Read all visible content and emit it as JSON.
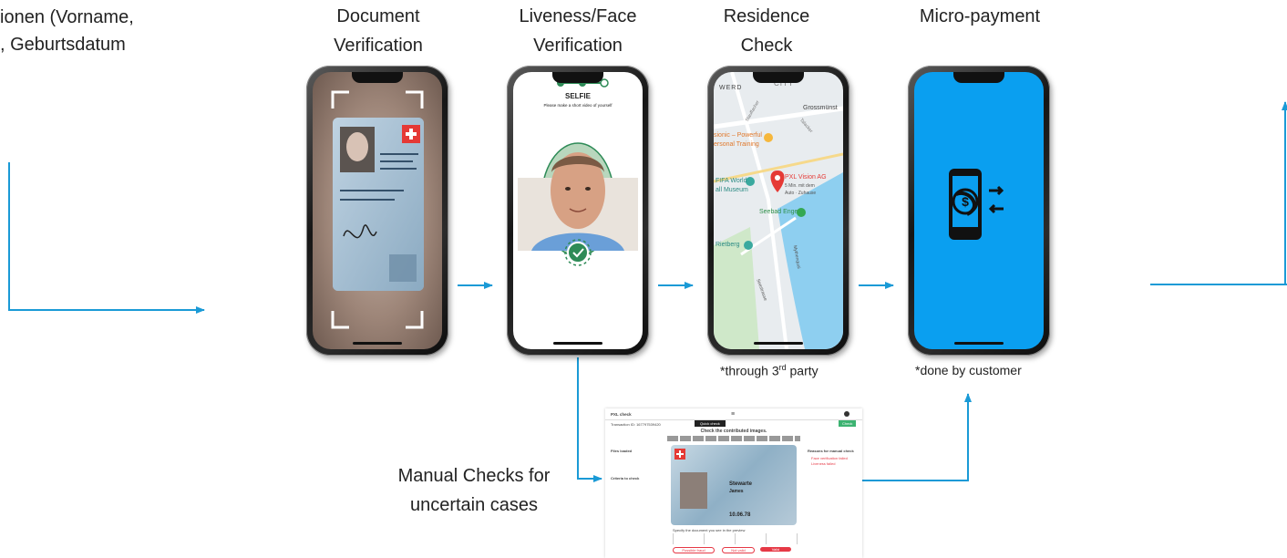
{
  "intro_text": {
    "line1": "ionen (Vorname,",
    "line2": ", Geburtsdatum"
  },
  "steps": [
    {
      "line1": "Document",
      "line2": "Verification"
    },
    {
      "line1": "Liveness/Face",
      "line2": "Verification"
    },
    {
      "line1": "Residence",
      "line2": "Check"
    },
    {
      "line1": "Micro-payment",
      "line2": ""
    }
  ],
  "selfie_screen": {
    "title": "SELFIE",
    "subtitle": "Please make a short video of yourself"
  },
  "map_screen": {
    "labels": [
      "WERD",
      "CITY",
      "Grossmünst",
      "Stauffacher",
      "Talacker",
      "sionic – Powerful",
      "ersonal Training",
      "PXL Vision AG",
      "5 Min. mit dem",
      "Auto · Zuhause",
      "FIFA World",
      "all Museum",
      "Seebad Enge",
      "Rietberg",
      "Mythenquai",
      "Seestrasse"
    ]
  },
  "notes": {
    "third_party": "*through 3",
    "third_party_sup": "rd",
    "third_party_tail": " party",
    "customer": "*done by customer"
  },
  "manual": {
    "line1": "Manual Checks for",
    "line2": "uncertain cases"
  },
  "manual_ui": {
    "logo": "PXL check",
    "transaction": "Transaction ID: 167797539420",
    "quick_check": "Quick check",
    "status_chip": "Check",
    "heading": "Check the contributed images.",
    "left_title": "Files loaded",
    "left_title2": "Criteria to check",
    "right_title": "Reasons for manual check",
    "reason1": "Face verification failed",
    "reason2": "Liveness failed",
    "doc_name": "Stewarte",
    "doc_given": "James",
    "doc_date": "10.06.78",
    "question": "Specify the document you see in the preview",
    "btn_fraud": "Possible fraud",
    "btn_not_valid": "Not valid",
    "btn_valid": "Valid"
  },
  "colors": {
    "arrow": "#1a9ad6",
    "payment_screen": "#0a9ff0",
    "accent_red": "#e63946",
    "verified_green": "#2e8b57"
  },
  "icons": [
    "payment-phone-icon",
    "check-icon",
    "map-pin-icon",
    "swiss-cross-icon"
  ]
}
